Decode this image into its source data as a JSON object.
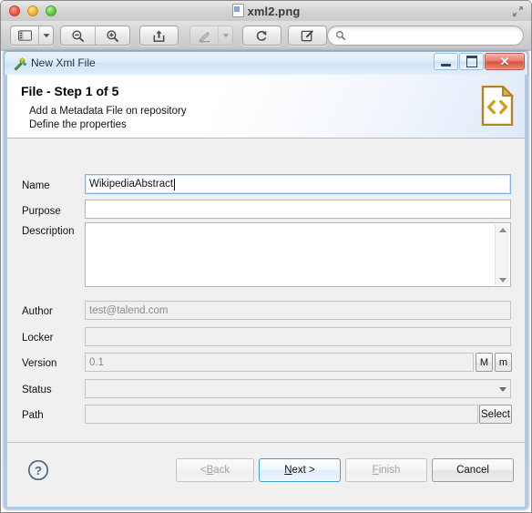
{
  "mac_window": {
    "title": "xml2.png",
    "title_icon": "image-file-icon",
    "traffic_lights": [
      {
        "name": "close-button",
        "color": "#e74b3c"
      },
      {
        "name": "minimize-button",
        "color": "#e8a92a"
      },
      {
        "name": "zoom-button",
        "color": "#53ba36"
      }
    ],
    "fullscreen_icon": "expand-arrows-icon",
    "toolbar": [
      {
        "name": "sidebar-toggle-button",
        "icon": "sidebar-icon"
      },
      {
        "name": "sidebar-menu-button",
        "icon": "chevron-down-icon"
      },
      {
        "name": "zoom-out-button",
        "icon": "magnifier-minus-icon"
      },
      {
        "name": "zoom-in-button",
        "icon": "magnifier-plus-icon"
      },
      {
        "name": "share-button",
        "icon": "share-arrow-icon"
      },
      {
        "name": "markup-button",
        "icon": "pen-icon",
        "disabled": true
      },
      {
        "name": "markup-menu-button",
        "icon": "chevron-down-icon",
        "disabled": true
      },
      {
        "name": "rotate-button",
        "icon": "rotate-left-icon"
      },
      {
        "name": "annotate-button",
        "icon": "edit-pencil-icon"
      }
    ],
    "search": {
      "placeholder": "",
      "value": "",
      "icon": "search-icon"
    }
  },
  "dialog": {
    "titlebar": {
      "icon": "new-wizard-icon",
      "title": "New Xml File",
      "minimize_label": "–",
      "maximize_label": "□",
      "close_label": "✕"
    },
    "header": {
      "heading": "File - Step 1 of 5",
      "line1": "Add a Metadata File on repository",
      "line2": "Define the properties",
      "icon": "xml-document-icon",
      "icon_color": "#b5851f"
    },
    "fields": [
      {
        "name": "name",
        "label": "Name",
        "value": "WikipediaAbstract",
        "placeholder": "",
        "type": "text",
        "focused": true,
        "readonly": false
      },
      {
        "name": "purpose",
        "label": "Purpose",
        "value": "",
        "placeholder": "",
        "type": "text",
        "focused": false,
        "readonly": false
      },
      {
        "name": "description",
        "label": "Description",
        "value": "",
        "placeholder": "",
        "type": "textarea",
        "focused": false,
        "readonly": false
      },
      {
        "name": "author",
        "label": "Author",
        "value": "test@talend.com",
        "placeholder": "",
        "type": "text",
        "focused": false,
        "readonly": true
      },
      {
        "name": "locker",
        "label": "Locker",
        "value": "",
        "placeholder": "",
        "type": "text",
        "focused": false,
        "readonly": true
      },
      {
        "name": "version",
        "label": "Version",
        "value": "0.1",
        "placeholder": "",
        "type": "text",
        "focused": false,
        "readonly": true
      },
      {
        "name": "status",
        "label": "Status",
        "value": "",
        "placeholder": "",
        "type": "combo",
        "focused": false,
        "readonly": true
      },
      {
        "name": "path",
        "label": "Path",
        "value": "",
        "placeholder": "",
        "type": "text",
        "focused": false,
        "readonly": true
      }
    ],
    "version_buttons": {
      "major_label": "M",
      "minor_label": "m"
    },
    "path_button_label": "Select",
    "footer": {
      "help_icon": "question-mark-icon",
      "buttons": [
        {
          "name": "back-button",
          "label_pre": "< ",
          "label_key": "B",
          "label_post": "ack",
          "disabled": true,
          "default": false
        },
        {
          "name": "next-button",
          "label_pre": "",
          "label_key": "N",
          "label_post": "ext >",
          "disabled": false,
          "default": true
        },
        {
          "name": "finish-button",
          "label_pre": "",
          "label_key": "F",
          "label_post": "inish",
          "disabled": true,
          "default": false
        },
        {
          "name": "cancel-button",
          "label_pre": "",
          "label_key": "",
          "label_post": "Cancel",
          "disabled": false,
          "default": false
        }
      ]
    }
  }
}
